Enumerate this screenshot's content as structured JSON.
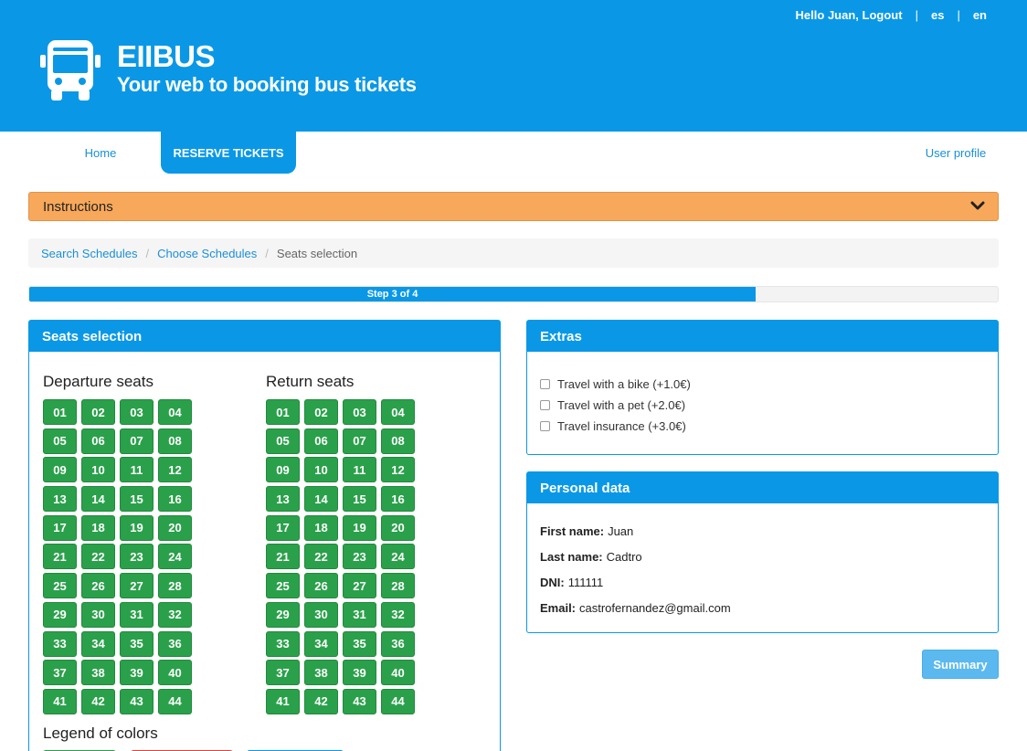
{
  "topbar": {
    "greeting": "Hello Juan,",
    "logout": "Logout",
    "sep": "|",
    "lang_es": "es",
    "lang_en": "en"
  },
  "brand": {
    "name": "EIIBUS",
    "tagline": "Your web to booking bus tickets"
  },
  "nav": {
    "home": "Home",
    "reserve": "RESERVE TICKETS",
    "profile": "User profile"
  },
  "instructions": {
    "label": "Instructions"
  },
  "breadcrumb": {
    "items": [
      "Search Schedules",
      "Choose Schedules"
    ],
    "active": "Seats selection",
    "separator": "/"
  },
  "progress": {
    "label": "Step 3 of 4",
    "fraction": 0.75
  },
  "seats": {
    "title": "Seats selection",
    "departure_title": "Departure seats",
    "return_title": "Return seats",
    "departure": [
      "01",
      "02",
      "03",
      "04",
      "05",
      "06",
      "07",
      "08",
      "09",
      "10",
      "11",
      "12",
      "13",
      "14",
      "15",
      "16",
      "17",
      "18",
      "19",
      "20",
      "21",
      "22",
      "23",
      "24",
      "25",
      "26",
      "27",
      "28",
      "29",
      "30",
      "31",
      "32",
      "33",
      "34",
      "35",
      "36",
      "37",
      "38",
      "39",
      "40",
      "41",
      "42",
      "43",
      "44"
    ],
    "return": [
      "01",
      "02",
      "03",
      "04",
      "05",
      "06",
      "07",
      "08",
      "09",
      "10",
      "11",
      "12",
      "13",
      "14",
      "15",
      "16",
      "17",
      "18",
      "19",
      "20",
      "21",
      "22",
      "23",
      "24",
      "25",
      "26",
      "27",
      "28",
      "29",
      "30",
      "31",
      "32",
      "33",
      "34",
      "35",
      "36",
      "37",
      "38",
      "39",
      "40",
      "41",
      "42",
      "43",
      "44"
    ],
    "legend_title": "Legend of colors",
    "legend_colors": [
      "#2aa04a",
      "#e0453f",
      "#0a98e6"
    ]
  },
  "extras": {
    "title": "Extras",
    "items": [
      "Travel with a bike (+1.0€)",
      "Travel with a pet (+2.0€)",
      "Travel insurance (+3.0€)"
    ]
  },
  "personal": {
    "title": "Personal data",
    "first_name_label": "First name:",
    "first_name": "Juan",
    "last_name_label": "Last name:",
    "last_name": "Cadtro",
    "dni_label": "DNI:",
    "dni": "111111",
    "email_label": "Email:",
    "email": "castrofernandez@gmail.com"
  },
  "actions": {
    "summary": "Summary"
  },
  "colors": {
    "primary": "#0a98e6",
    "instructions": "#f8a85a",
    "seat_available": "#2aa04a",
    "summary_button": "#5bb9ef"
  },
  "icons": {
    "logo": "bus-icon",
    "instructions_toggle": "chevron-down-icon",
    "extras": "checkbox-icon"
  }
}
